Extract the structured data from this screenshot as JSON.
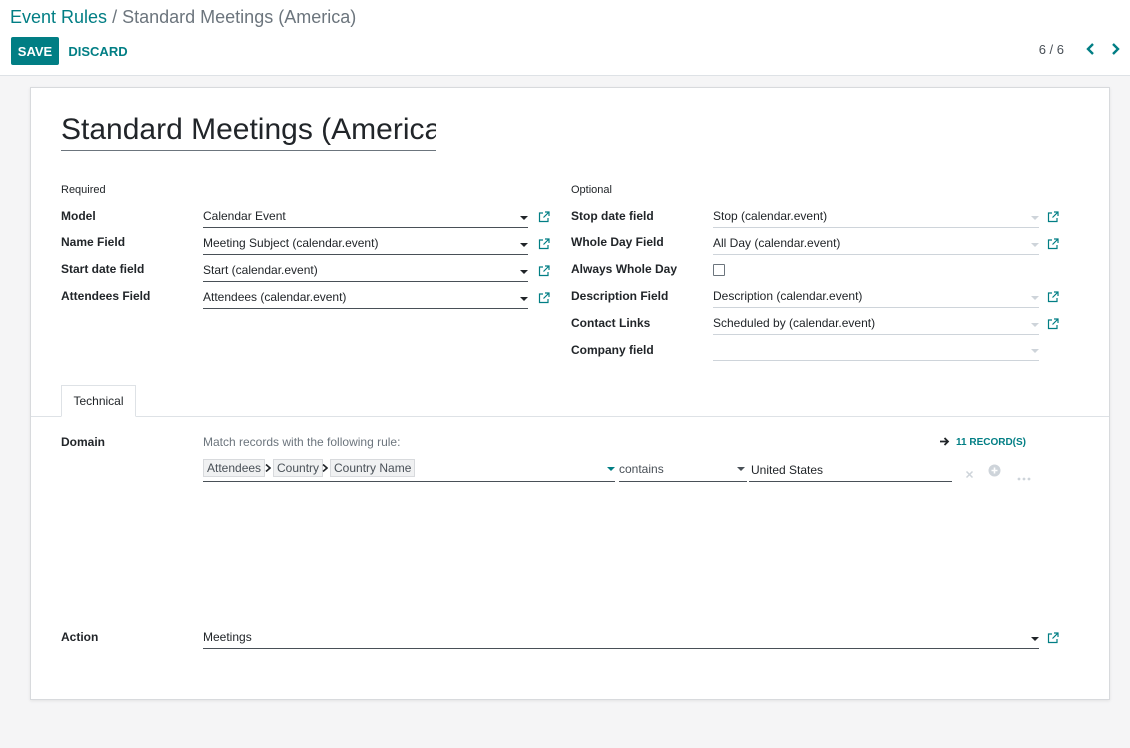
{
  "breadcrumb": {
    "parent": "Event Rules",
    "separator": "/",
    "current": "Standard Meetings (America)"
  },
  "toolbar": {
    "save_label": "SAVE",
    "discard_label": "DISCARD"
  },
  "pager": {
    "value": "6 / 6",
    "prev_icon": "chevron-left-icon",
    "next_icon": "chevron-right-icon"
  },
  "record": {
    "title": "Standard Meetings (America"
  },
  "required": {
    "heading": "Required",
    "fields": [
      {
        "label": "Model",
        "value": "Calendar Event"
      },
      {
        "label": "Name Field",
        "value": "Meeting Subject (calendar.event)"
      },
      {
        "label": "Start date field",
        "value": "Start (calendar.event)"
      },
      {
        "label": "Attendees Field",
        "value": "Attendees (calendar.event)"
      }
    ]
  },
  "optional": {
    "heading": "Optional",
    "fields": [
      {
        "label": "Stop date field",
        "value": "Stop (calendar.event)"
      },
      {
        "label": "Whole Day Field",
        "value": "All Day (calendar.event)"
      },
      {
        "label": "Always Whole Day",
        "checked": false
      },
      {
        "label": "Description Field",
        "value": "Description (calendar.event)"
      },
      {
        "label": "Contact Links",
        "value": "Scheduled by (calendar.event)"
      },
      {
        "label": "Company field",
        "value": ""
      }
    ]
  },
  "tabs": [
    {
      "label": "Technical",
      "active": true
    }
  ],
  "domain": {
    "label": "Domain",
    "description": "Match records with the following rule:",
    "records_link": "11 RECORD(S)",
    "rule": {
      "path": [
        "Attendees",
        "Country",
        "Country Name"
      ],
      "operator": "contains",
      "value": "United States"
    }
  },
  "action": {
    "label": "Action",
    "value": "Meetings"
  },
  "colors": {
    "primary": "#017e84",
    "text": "#212529",
    "muted": "#6c757d",
    "background": "#f5f5f6"
  }
}
